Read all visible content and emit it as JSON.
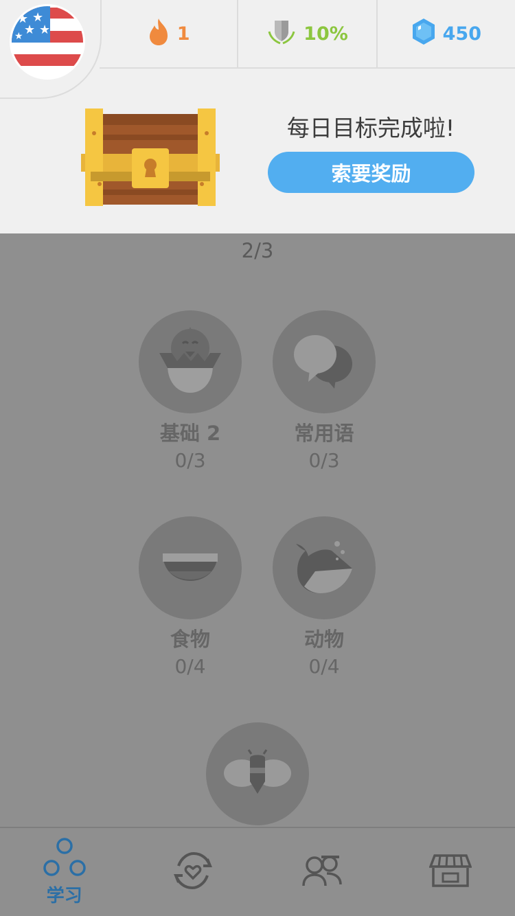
{
  "header": {
    "streak": "1",
    "league": "10%",
    "gems": "450"
  },
  "daily_goal": {
    "message": "每日目标完成啦!",
    "claim_label": "索要奖励"
  },
  "path": {
    "progress": "2/3",
    "skills": [
      {
        "name": "基础 2",
        "progress": "0/3",
        "icon": "hatching-chick-icon"
      },
      {
        "name": "常用语",
        "progress": "0/3",
        "icon": "speech-bubbles-icon"
      },
      {
        "name": "食物",
        "progress": "0/4",
        "icon": "bowl-icon"
      },
      {
        "name": "动物",
        "progress": "0/4",
        "icon": "whale-icon"
      },
      {
        "name": "",
        "progress": "",
        "icon": "bee-icon"
      }
    ]
  },
  "tabbar": {
    "tabs": [
      {
        "label": "学习",
        "icon": "learn-icon",
        "active": true
      },
      {
        "label": "",
        "icon": "practice-heart-icon",
        "active": false
      },
      {
        "label": "",
        "icon": "friends-icon",
        "active": false
      },
      {
        "label": "",
        "icon": "shop-icon",
        "active": false
      }
    ]
  },
  "colors": {
    "accent_blue": "#52aef0",
    "streak_orange": "#f08a3e",
    "league_green": "#8cc63f",
    "gem_blue": "#48a7ee",
    "overlay_gray": "#8f8f8f"
  }
}
